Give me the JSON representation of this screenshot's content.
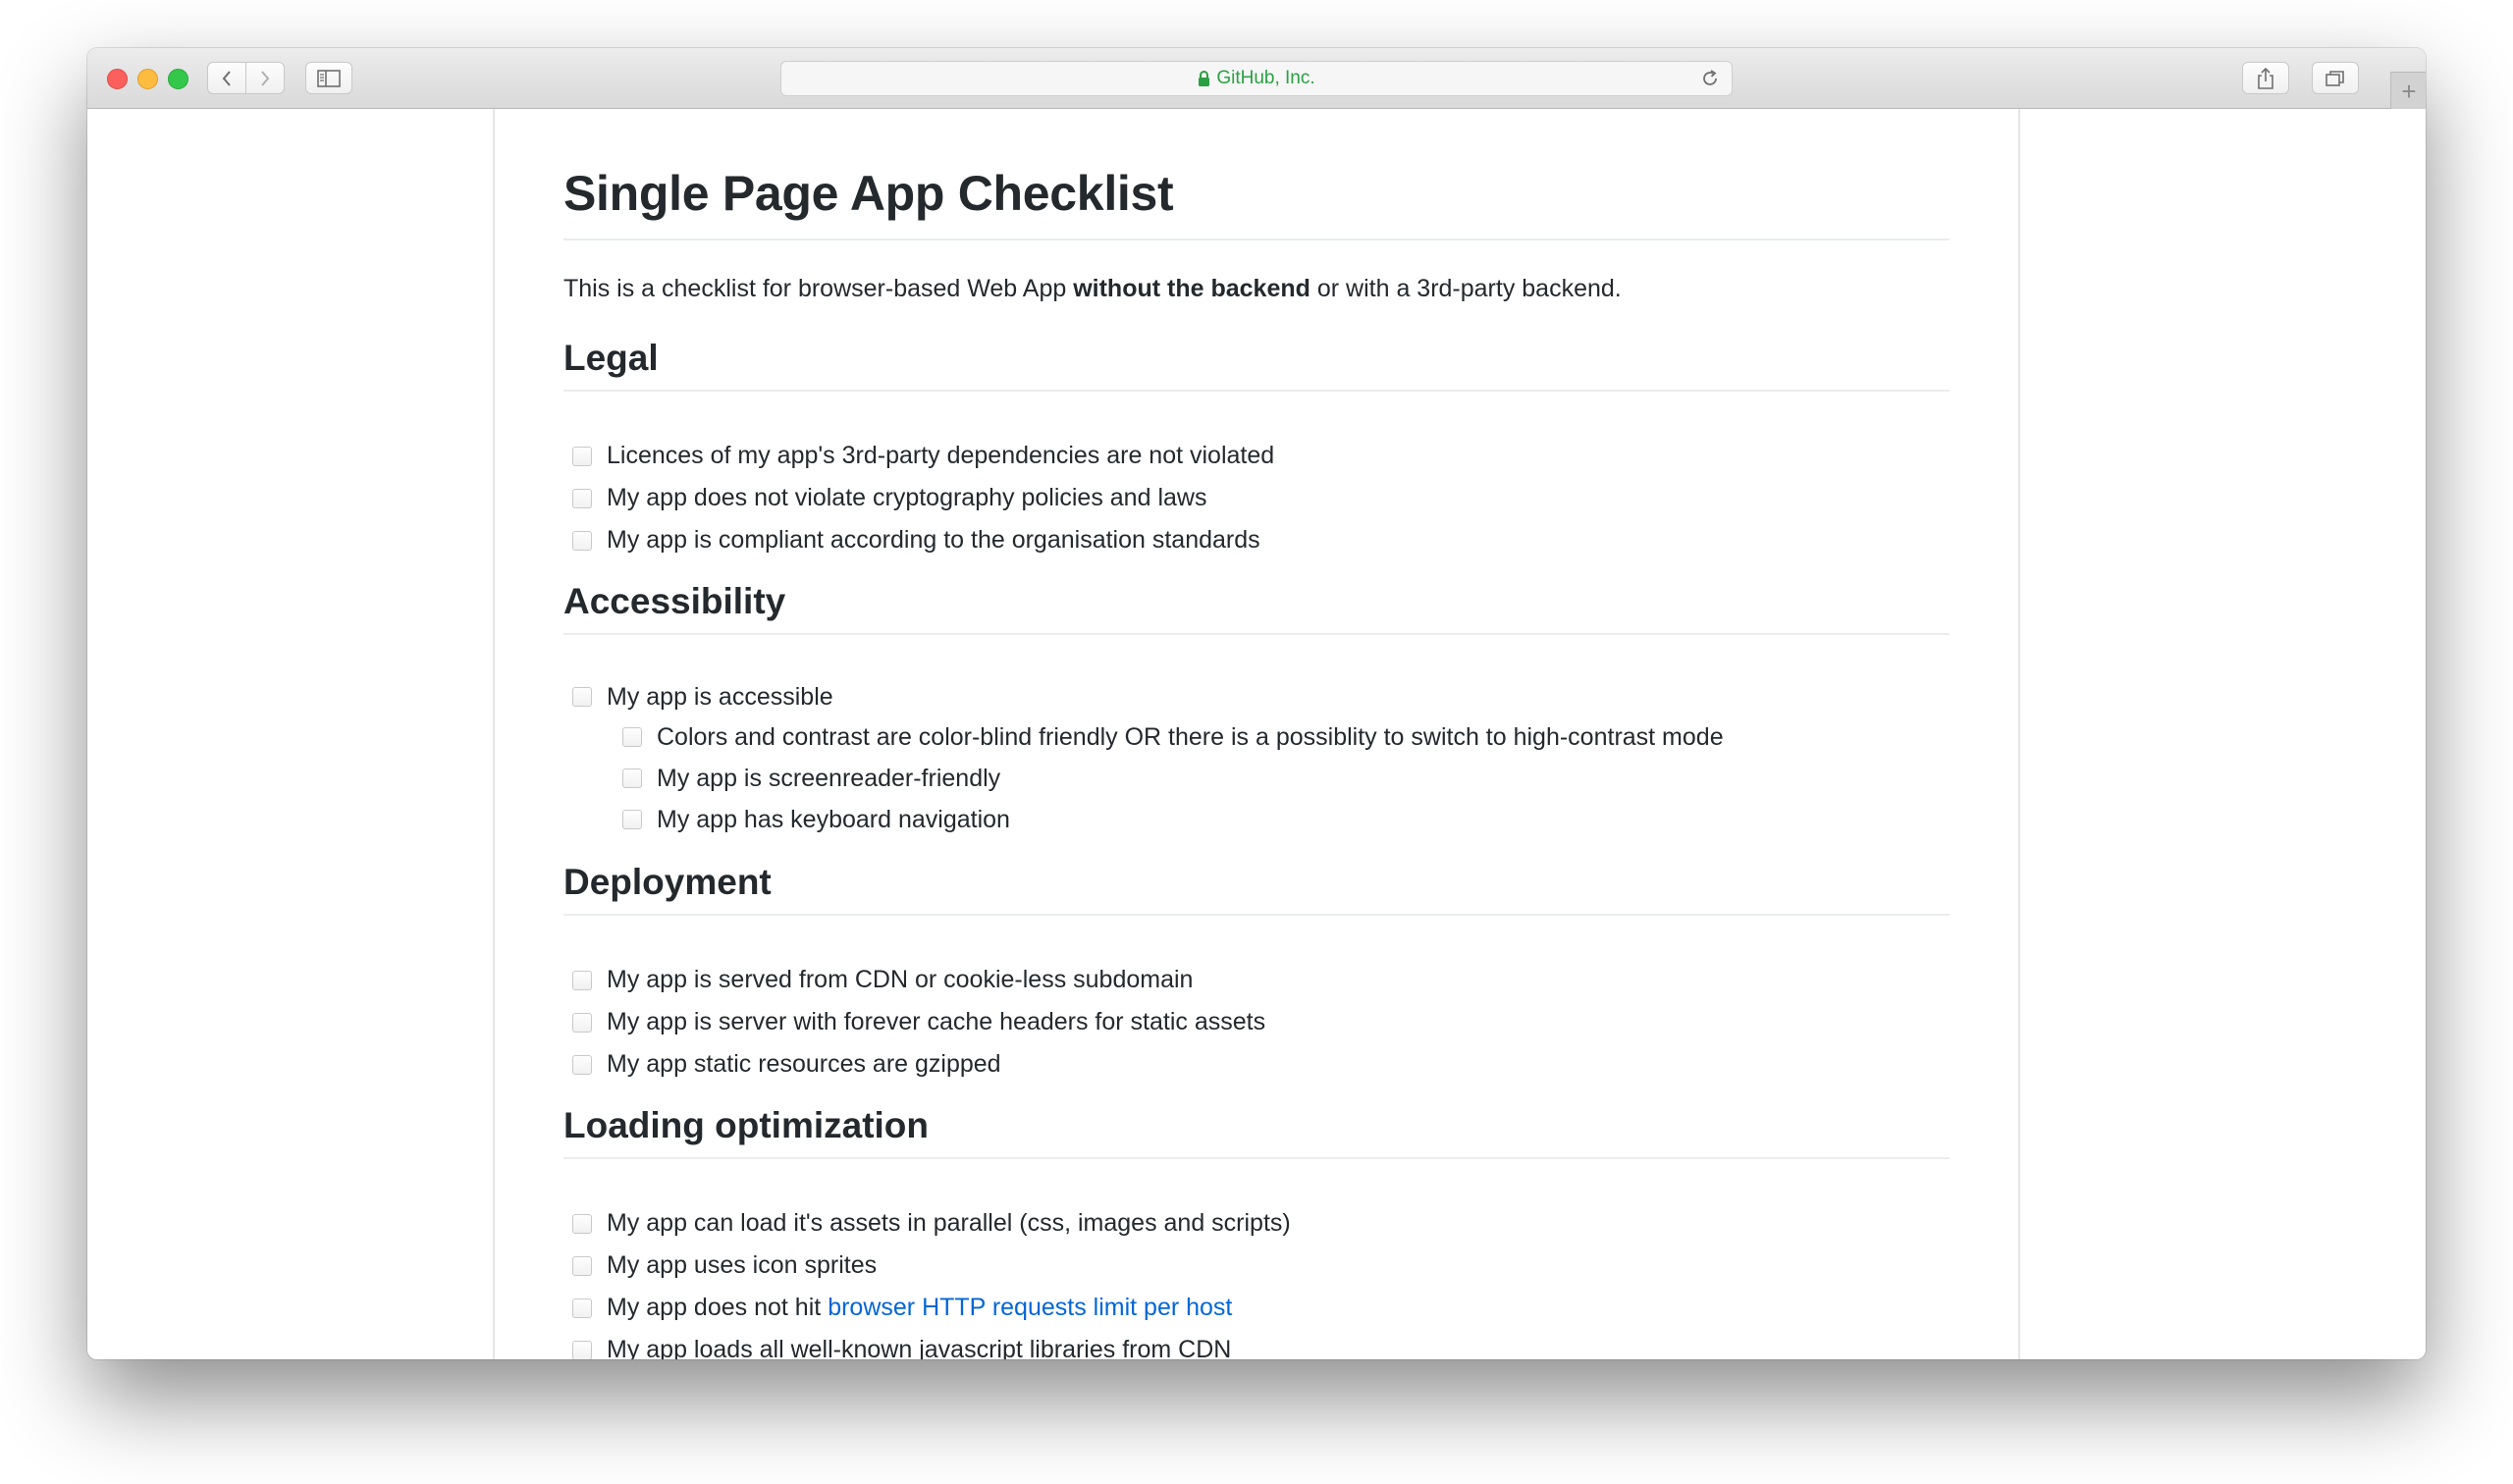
{
  "browser": {
    "address_text": "GitHub, Inc.",
    "lock_color": "#2aa043"
  },
  "page": {
    "title": "Single Page App Checklist",
    "intro": {
      "before": "This is a checklist for browser-based Web App",
      "bold": "without the backend",
      "after": "or with a 3rd-party backend."
    },
    "sections": {
      "legal": {
        "heading": "Legal",
        "items": [
          "Licences of my app's 3rd-party dependencies are not violated",
          "My app does not violate cryptography policies and laws",
          "My app is compliant according to the organisation standards"
        ]
      },
      "accessibility": {
        "heading": "Accessibility",
        "items": [
          "My app is accessible",
          "Colors and contrast are color-blind friendly OR there is a possiblity to switch to high-contrast mode",
          "My app is screenreader-friendly",
          "My app has keyboard navigation"
        ]
      },
      "deployment": {
        "heading": "Deployment",
        "items": [
          "My app is served from CDN or cookie-less subdomain",
          "My app is server with forever cache headers for static assets",
          "My app static resources are gzipped"
        ]
      },
      "loading": {
        "heading": "Loading optimization",
        "items": [
          "My app can load it's assets in parallel (css, images and scripts)",
          "My app uses icon sprites",
          "My app does not hit",
          "My app loads all well-known javascript libraries from CDN"
        ],
        "link_text": "browser HTTP requests limit per host",
        "link_color": "#0366d6"
      }
    }
  }
}
